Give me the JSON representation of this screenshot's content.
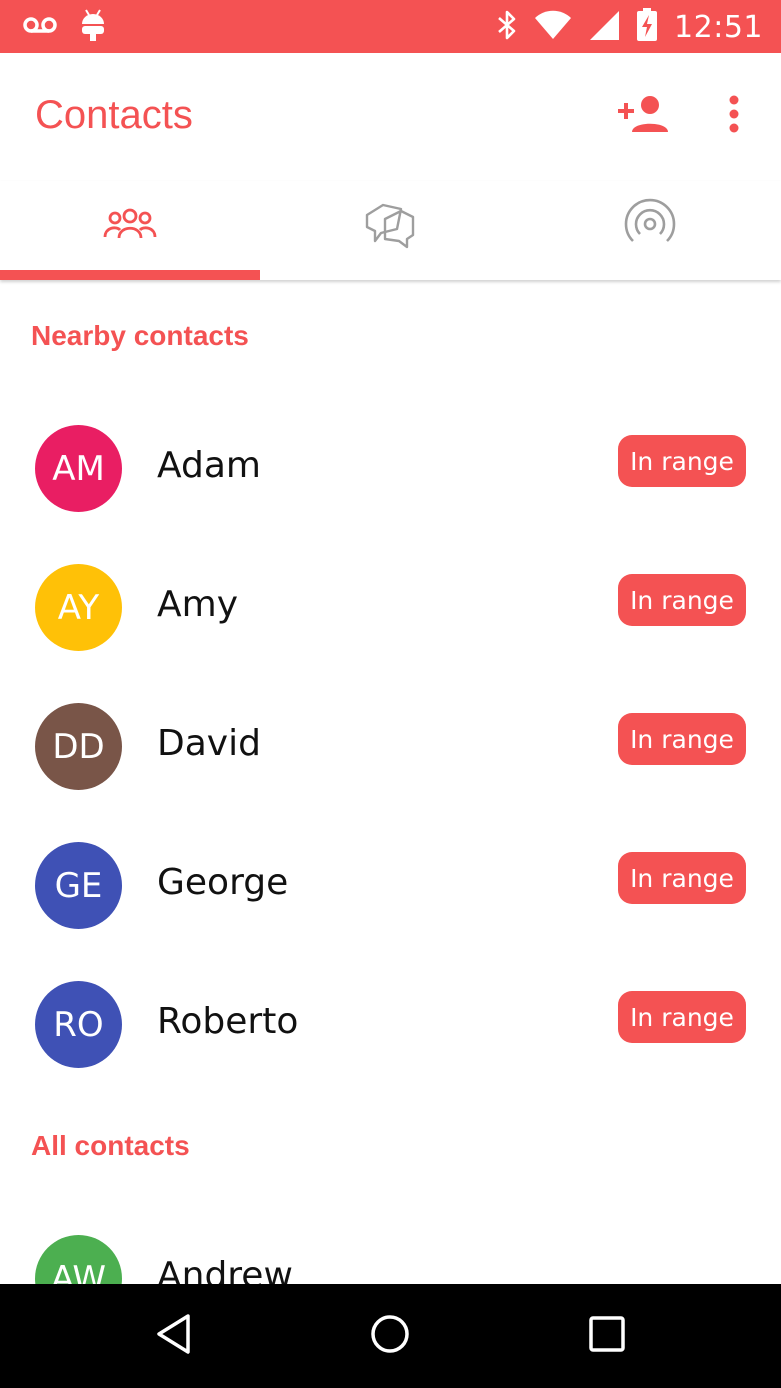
{
  "status_bar": {
    "time": "12:51",
    "icons": [
      "voicemail-icon",
      "android-debug-icon",
      "bluetooth-icon",
      "wifi-icon",
      "signal-icon",
      "battery-charging-icon"
    ]
  },
  "app_bar": {
    "title": "Contacts",
    "actions": [
      "add-contact-icon",
      "more-vert-icon"
    ]
  },
  "tabs": [
    {
      "icon": "people-icon",
      "selected": true
    },
    {
      "icon": "conversations-icon",
      "selected": false
    },
    {
      "icon": "broadcast-icon",
      "selected": false
    }
  ],
  "sections": {
    "nearby": {
      "title": "Nearby contacts",
      "contacts": [
        {
          "initials": "AM",
          "name": "Adam",
          "badge": "In range",
          "color": "#e91e63"
        },
        {
          "initials": "AY",
          "name": "Amy",
          "badge": "In range",
          "color": "#ffc107"
        },
        {
          "initials": "DD",
          "name": "David",
          "badge": "In range",
          "color": "#795548"
        },
        {
          "initials": "GE",
          "name": "George",
          "badge": "In range",
          "color": "#3f51b5"
        },
        {
          "initials": "RO",
          "name": "Roberto",
          "badge": "In range",
          "color": "#3f51b5"
        }
      ]
    },
    "all": {
      "title": "All contacts",
      "contacts": [
        {
          "initials": "AW",
          "name": "Andrew",
          "color": "#4caf50"
        }
      ]
    }
  },
  "nav_bar": [
    "back-icon",
    "home-icon",
    "recents-icon"
  ],
  "colors": {
    "accent": "#f45253",
    "inactive_icon": "#9e9e9e"
  }
}
